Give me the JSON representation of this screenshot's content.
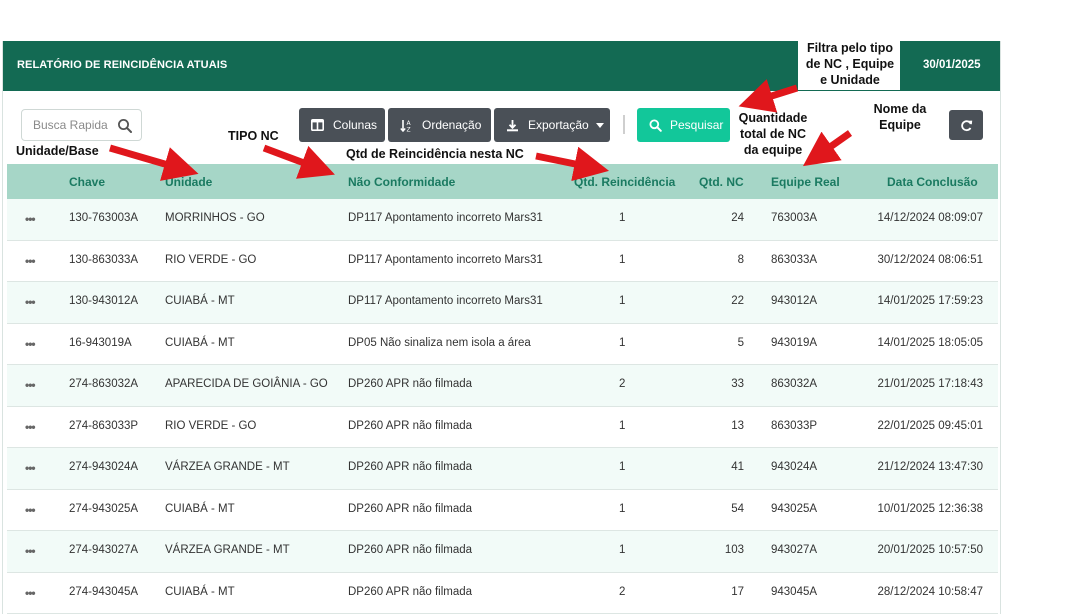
{
  "header": {
    "title": "RELATÓRIO DE REINCIDÊNCIA ATUAIS",
    "date": "30/01/2025"
  },
  "search": {
    "placeholder": "Busca Rapida"
  },
  "toolbar": {
    "columns_label": "Colunas",
    "sort_label": "Ordenação",
    "export_label": "Exportação",
    "search_label": "Pesquisar"
  },
  "table": {
    "columns": [
      "Chave",
      "Unidade",
      "Não Conformidade",
      "Qtd. Reincidência",
      "Qtd. NC",
      "Equipe Real",
      "Data Conclusão"
    ],
    "rows": [
      [
        "130-763003A",
        "MORRINHOS - GO",
        "DP117 Apontamento incorreto Mars31",
        "1",
        "24",
        "763003A",
        "14/12/2024 08:09:07"
      ],
      [
        "130-863033A",
        "RIO VERDE - GO",
        "DP117 Apontamento incorreto Mars31",
        "1",
        "8",
        "863033A",
        "30/12/2024 08:06:51"
      ],
      [
        "130-943012A",
        "CUIABÁ - MT",
        "DP117 Apontamento incorreto Mars31",
        "1",
        "22",
        "943012A",
        "14/01/2025 17:59:23"
      ],
      [
        "16-943019A",
        "CUIABÁ - MT",
        "DP05 Não sinaliza nem isola a área",
        "1",
        "5",
        "943019A",
        "14/01/2025 18:05:05"
      ],
      [
        "274-863032A",
        "APARECIDA DE GOIÂNIA - GO",
        "DP260 APR não filmada",
        "2",
        "33",
        "863032A",
        "21/01/2025 17:18:43"
      ],
      [
        "274-863033P",
        "RIO VERDE - GO",
        "DP260 APR não filmada",
        "1",
        "13",
        "863033P",
        "22/01/2025 09:45:01"
      ],
      [
        "274-943024A",
        "VÁRZEA GRANDE - MT",
        "DP260 APR não filmada",
        "1",
        "41",
        "943024A",
        "21/12/2024 13:47:30"
      ],
      [
        "274-943025A",
        "CUIABÁ - MT",
        "DP260 APR não filmada",
        "1",
        "54",
        "943025A",
        "10/01/2025 12:36:38"
      ],
      [
        "274-943027A",
        "VÁRZEA GRANDE - MT",
        "DP260 APR não filmada",
        "1",
        "103",
        "943027A",
        "20/01/2025 10:57:50"
      ],
      [
        "274-943045A",
        "CUIABÁ - MT",
        "DP260 APR não filmada",
        "2",
        "17",
        "943045A",
        "28/12/2024 10:58:47"
      ]
    ]
  },
  "annotations": {
    "filter": [
      "Filtra pelo tipo",
      "de NC , Equipe",
      "e Unidade"
    ],
    "team_name": [
      "Nome da",
      "Equipe"
    ],
    "total_nc": [
      "Quantidade",
      "total de NC",
      "da equipe"
    ],
    "tipo_nc": "TIPO NC",
    "unidade_base": "Unidade/Base",
    "qtd_reincidencia": "Qtd de Reincidência nesta NC"
  },
  "colors": {
    "header_bg": "#136a53",
    "table_header_bg": "#a6d6c7",
    "table_header_text": "#1a7a61",
    "search_button": "#12c79a",
    "toolbar_button": "#4a5057",
    "row_alt": "#f2fbf8",
    "arrow": "#e0171c"
  }
}
